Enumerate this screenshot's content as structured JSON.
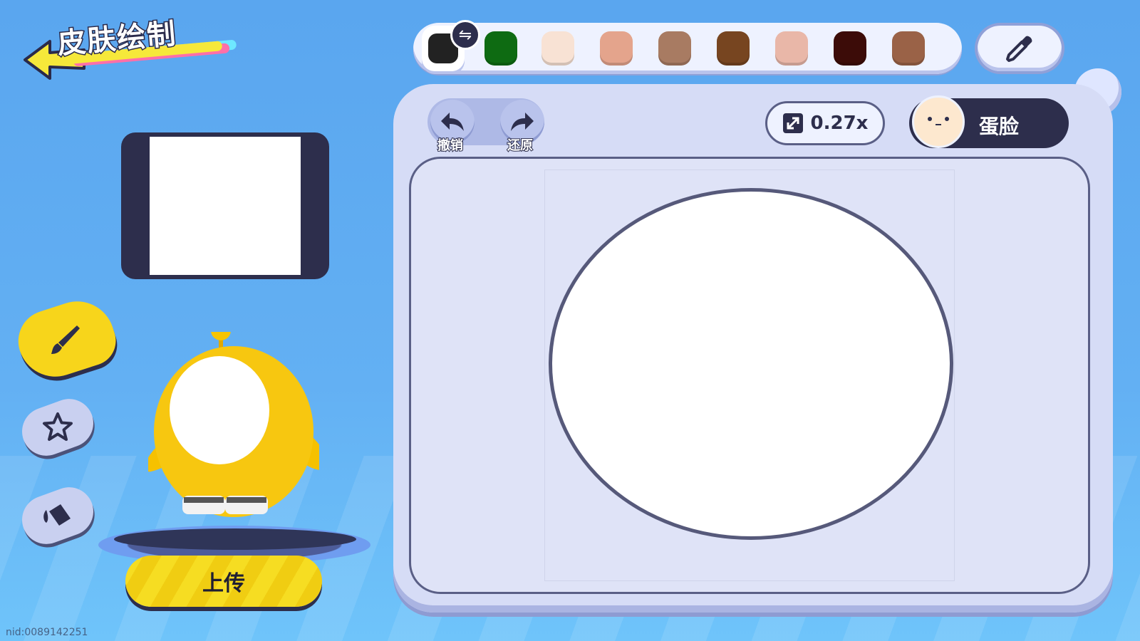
{
  "header": {
    "title": "皮肤绘制",
    "back_icon": "back-arrow-icon"
  },
  "palette": {
    "colors": [
      "#222222",
      "#0e6b12",
      "#f8e2d4",
      "#e4a48c",
      "#a87b62",
      "#774520",
      "#e9b7a8",
      "#3c0c08",
      "#9a6247"
    ],
    "selected_index": 0
  },
  "toolbar": {
    "undo_label": "撤销",
    "redo_label": "还原",
    "zoom_value": "0.27x",
    "face_mode_label": "蛋脸"
  },
  "left_tools": [
    "brush-icon",
    "sticker-star-icon",
    "fill-bucket-icon"
  ],
  "upload": {
    "label": "上传"
  },
  "footer": {
    "nid": "nid:0089142251"
  }
}
